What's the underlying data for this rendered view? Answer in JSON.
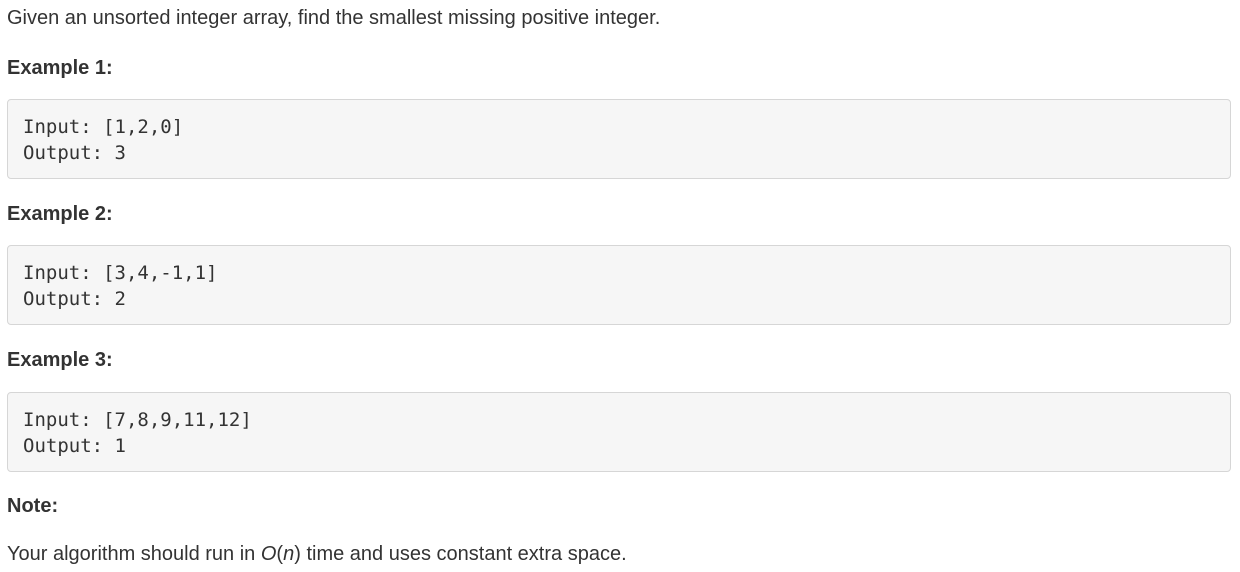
{
  "intro": "Given an unsorted integer array, find the smallest missing positive integer.",
  "examples": [
    {
      "heading": "Example 1:",
      "input": "Input: [1,2,0]",
      "output": "Output: 3"
    },
    {
      "heading": "Example 2:",
      "input": "Input: [3,4,-1,1]",
      "output": "Output: 2"
    },
    {
      "heading": "Example 3:",
      "input": "Input: [7,8,9,11,12]",
      "output": "Output: 1"
    }
  ],
  "note": {
    "heading": "Note:",
    "text_before": "Your algorithm should run in ",
    "big_o": "O",
    "open_paren": "(",
    "n": "n",
    "close_paren": ")",
    "text_after": " time and uses constant extra space."
  }
}
